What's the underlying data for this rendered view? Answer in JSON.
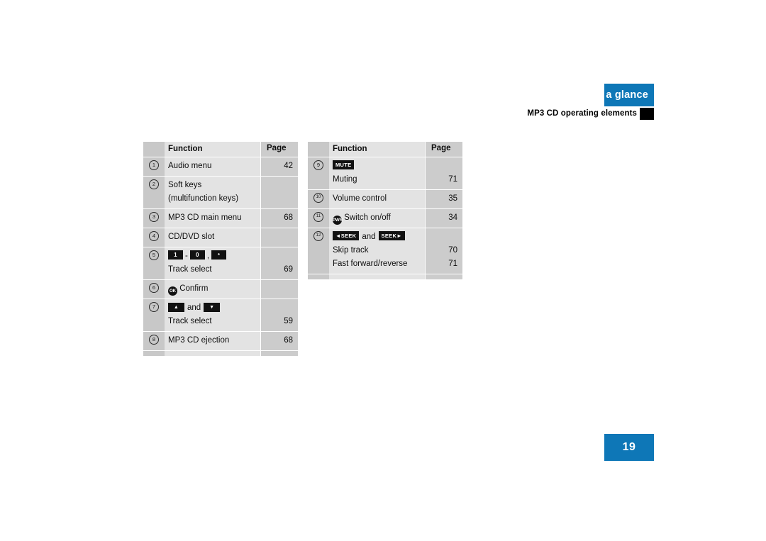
{
  "colors": {
    "accent": "#0e77b7",
    "marker": "#000000"
  },
  "header": {
    "title": "At a glance",
    "subtitle": "MP3 CD operating elements"
  },
  "page_number": "19",
  "tables": [
    {
      "name": "left-table",
      "columns": {
        "num": "",
        "function": "Function",
        "page": "Page"
      },
      "rows": [
        {
          "num": "1",
          "lines": [
            {
              "text": "Audio menu"
            }
          ],
          "pages": [
            "42"
          ]
        },
        {
          "num": "2",
          "lines": [
            {
              "text": "Soft keys"
            },
            {
              "text": "(multifunction keys)"
            }
          ],
          "pages": [
            "",
            ""
          ]
        },
        {
          "num": "3",
          "lines": [
            {
              "text": "MP3 CD main menu"
            }
          ],
          "pages": [
            "68"
          ]
        },
        {
          "num": "4",
          "lines": [
            {
              "text": "CD/DVD slot"
            }
          ],
          "pages": [
            ""
          ]
        },
        {
          "num": "5",
          "lines": [
            {
              "keys": [
                "1",
                "-",
                "0",
                ",",
                "*"
              ]
            },
            {
              "text": "Track select"
            }
          ],
          "pages": [
            "",
            "69"
          ]
        },
        {
          "num": "6",
          "lines": [
            {
              "round": "OK",
              "text": "Confirm"
            }
          ],
          "pages": [
            ""
          ]
        },
        {
          "num": "7",
          "lines": [
            {
              "keys": [
                "▲",
                "and",
                "▼"
              ]
            },
            {
              "text": "Track select"
            }
          ],
          "pages": [
            "",
            "59"
          ]
        },
        {
          "num": "8",
          "lines": [
            {
              "text": "MP3 CD ejection"
            }
          ],
          "pages": [
            "68"
          ]
        }
      ]
    },
    {
      "name": "right-table",
      "columns": {
        "num": "",
        "function": "Function",
        "page": "Page"
      },
      "rows": [
        {
          "num": "9",
          "lines": [
            {
              "keys": [
                "MUTE"
              ]
            },
            {
              "text": "Muting"
            }
          ],
          "pages": [
            "",
            "71"
          ]
        },
        {
          "num": "10",
          "lines": [
            {
              "text": "Volume control"
            }
          ],
          "pages": [
            "35"
          ]
        },
        {
          "num": "11",
          "lines": [
            {
              "round": "PWR",
              "text": "Switch on/off"
            }
          ],
          "pages": [
            "34"
          ]
        },
        {
          "num": "12",
          "lines": [
            {
              "keys": [
                "◄SEEK",
                "and",
                "SEEK►"
              ]
            },
            {
              "text": "Skip track"
            },
            {
              "text": "Fast forward/reverse"
            }
          ],
          "pages": [
            "",
            "70",
            "71"
          ]
        }
      ]
    }
  ]
}
